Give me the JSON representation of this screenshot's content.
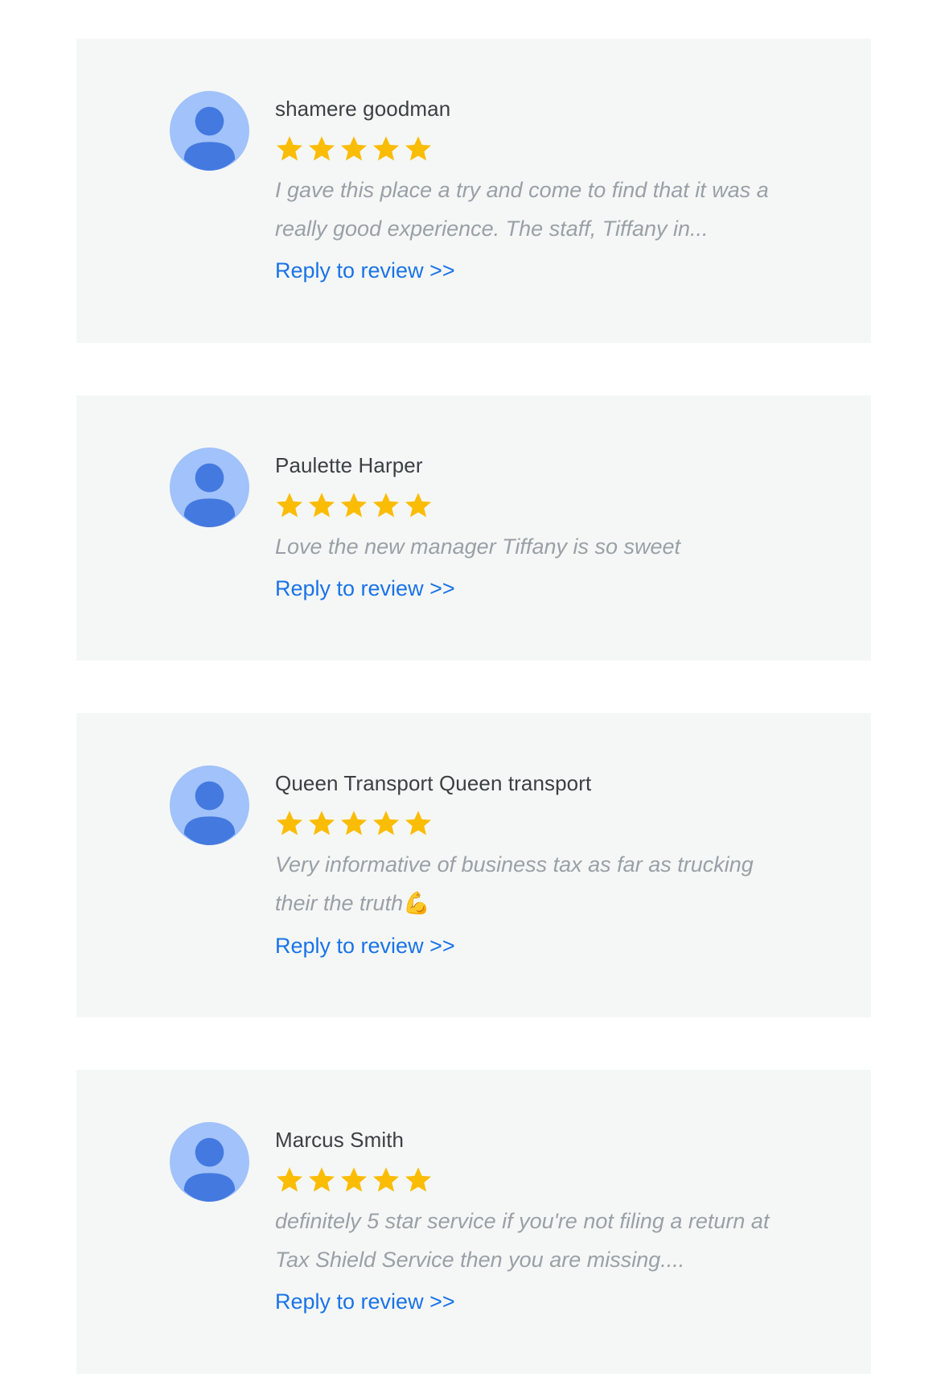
{
  "colors": {
    "card_background": "#f5f7f6",
    "avatar_light": "#a1c2fa",
    "avatar_dark": "#4479e0",
    "star": "#fbbc04",
    "name": "#3c4043",
    "review_text": "#9aa0a6",
    "link": "#1a73e8"
  },
  "reviews": [
    {
      "name": "shamere goodman",
      "rating": 5,
      "text": "I gave this place a try and come to find that it was a really good experience. The staff, Tiffany in...",
      "reply_label": "Reply to review >>"
    },
    {
      "name": "Paulette Harper",
      "rating": 5,
      "text": "Love the new manager Tiffany is so sweet",
      "reply_label": "Reply to review >>"
    },
    {
      "name": "Queen Transport Queen transport",
      "rating": 5,
      "text": "Very informative of business tax as far as trucking their the truth",
      "emoji": "💪",
      "reply_label": "Reply to review >>"
    },
    {
      "name": "Marcus Smith",
      "rating": 5,
      "text": "definitely 5 star service if you're not filing a return at Tax Shield Service then you are missing....",
      "reply_label": "Reply to review >>"
    }
  ]
}
